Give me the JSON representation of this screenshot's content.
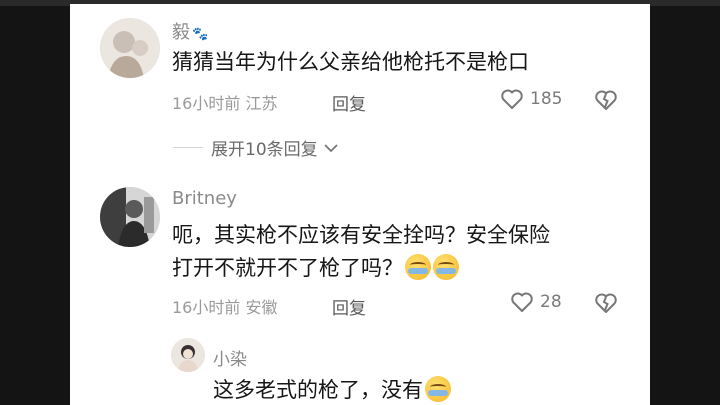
{
  "comments": [
    {
      "user": "毅",
      "badge": "🐾",
      "text_lines": [
        "猜猜当年为什么父亲给他枪托不是枪口"
      ],
      "meta": "16小时前 江苏",
      "reply_label": "回复",
      "likes": "185"
    },
    {
      "user": "Britney",
      "text_lines": [
        "呃，其实枪不应该有安全拴吗？安全保险",
        "打开不就开不了枪了吗？"
      ],
      "meta": "16小时前 安徽",
      "reply_label": "回复",
      "likes": "28"
    }
  ],
  "expand_replies": "展开10条回复",
  "sub_reply": {
    "user": "小染",
    "text": "这多老式的枪了，没有"
  },
  "icons": {
    "like": "heart-outline-icon",
    "dislike": "broken-heart-icon",
    "expand": "chevron-down-icon",
    "emoji": "crying-laughing-emoji"
  }
}
